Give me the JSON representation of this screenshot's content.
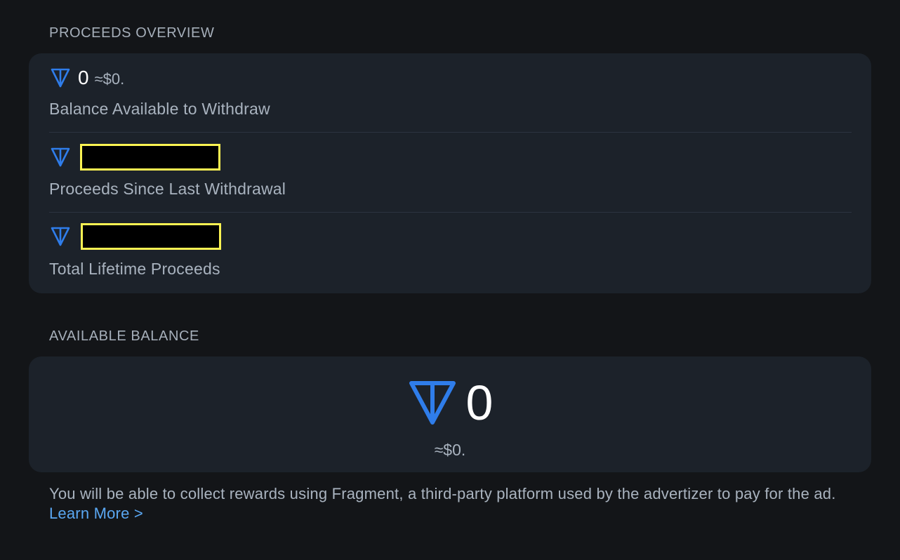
{
  "proceeds_overview": {
    "header": "PROCEEDS OVERVIEW",
    "rows": [
      {
        "amount": "0",
        "approx": "≈$0.",
        "label": "Balance Available to Withdraw",
        "icon": "ton-icon"
      },
      {
        "amount_redacted": true,
        "label": "Proceeds Since Last Withdrawal",
        "icon": "ton-icon"
      },
      {
        "amount_redacted": true,
        "label": "Total Lifetime Proceeds",
        "icon": "ton-icon"
      }
    ]
  },
  "available_balance": {
    "header": "AVAILABLE BALANCE",
    "amount": "0",
    "approx": "≈$0.",
    "icon": "ton-icon"
  },
  "footnote": {
    "text": "You will be able to collect rewards using Fragment, a third-party platform used by the advertizer to pay for the ad. ",
    "link": "Learn More >"
  },
  "colors": {
    "background": "#131518",
    "card": "#1c222a",
    "accent_blue": "#2f7dea",
    "link": "#5aa7f2",
    "redaction_border": "#fdf352"
  }
}
